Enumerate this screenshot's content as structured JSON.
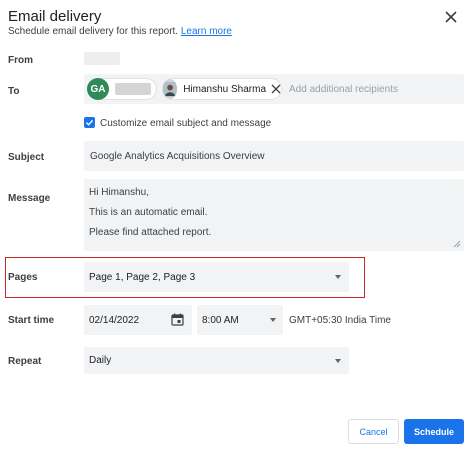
{
  "dialog": {
    "title": "Email delivery",
    "subtitle": "Schedule email delivery for this report.",
    "learn_more": "Learn more"
  },
  "labels": {
    "from": "From",
    "to": "To",
    "subject": "Subject",
    "message": "Message",
    "pages": "Pages",
    "start_time": "Start time",
    "repeat": "Repeat"
  },
  "to": {
    "recipients": [
      {
        "avatar_text": "GA",
        "avatar_color": "#2e8b57",
        "name": ""
      },
      {
        "avatar_text": "",
        "name": "Himanshu Sharma"
      }
    ],
    "placeholder": "Add additional recipients"
  },
  "customize": {
    "checked": true,
    "label": "Customize email subject and message"
  },
  "subject": {
    "value": "Google Analytics Acquisitions Overview"
  },
  "message": {
    "lines": [
      "Hi Himanshu,",
      "This is an automatic email.",
      "Please find attached report."
    ]
  },
  "pages": {
    "value": "Page 1, Page 2, Page 3"
  },
  "start_time": {
    "date": "02/14/2022",
    "time": "8:00 AM",
    "timezone": "GMT+05:30 India Time"
  },
  "repeat": {
    "value": "Daily"
  },
  "buttons": {
    "cancel": "Cancel",
    "schedule": "Schedule"
  },
  "colors": {
    "accent": "#1a73e8",
    "highlight": "#c62828",
    "field_bg": "#f1f3f4"
  }
}
